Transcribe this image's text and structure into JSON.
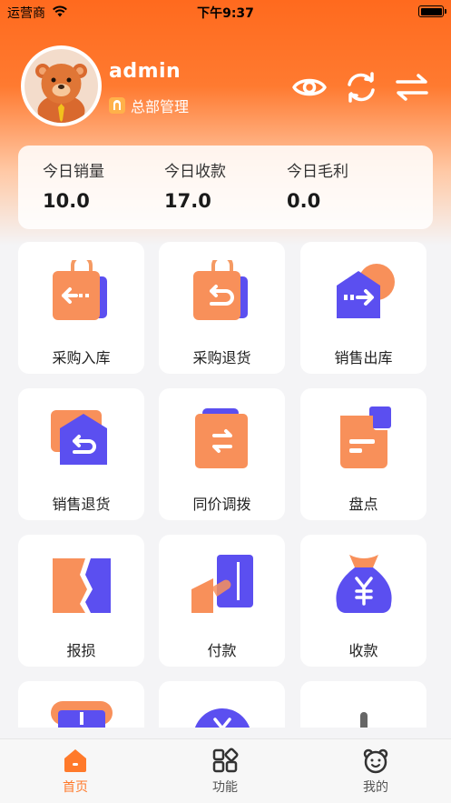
{
  "status_bar": {
    "carrier": "运营商",
    "time": "下午9:37"
  },
  "profile": {
    "username": "admin",
    "role": "总部管理"
  },
  "stats": [
    {
      "label": "今日销量",
      "value": "10.0"
    },
    {
      "label": "今日收款",
      "value": "17.0"
    },
    {
      "label": "今日毛利",
      "value": "0.0"
    }
  ],
  "functions": [
    {
      "label": "采购入库",
      "icon": "purchase-in-icon"
    },
    {
      "label": "采购退货",
      "icon": "purchase-return-icon"
    },
    {
      "label": "销售出库",
      "icon": "sales-out-icon"
    },
    {
      "label": "销售退货",
      "icon": "sales-return-icon"
    },
    {
      "label": "同价调拨",
      "icon": "transfer-icon"
    },
    {
      "label": "盘点",
      "icon": "inventory-count-icon"
    },
    {
      "label": "报损",
      "icon": "damage-report-icon"
    },
    {
      "label": "付款",
      "icon": "payment-icon"
    },
    {
      "label": "收款",
      "icon": "receipt-icon"
    }
  ],
  "tabbar": [
    {
      "label": "首页",
      "icon": "home-icon",
      "active": true
    },
    {
      "label": "功能",
      "icon": "apps-icon",
      "active": false
    },
    {
      "label": "我的",
      "icon": "bear-face-icon",
      "active": false
    }
  ],
  "colors": {
    "accent": "#ff7a2b",
    "header": "#ff6a1e",
    "purple": "#5b4ff0"
  }
}
